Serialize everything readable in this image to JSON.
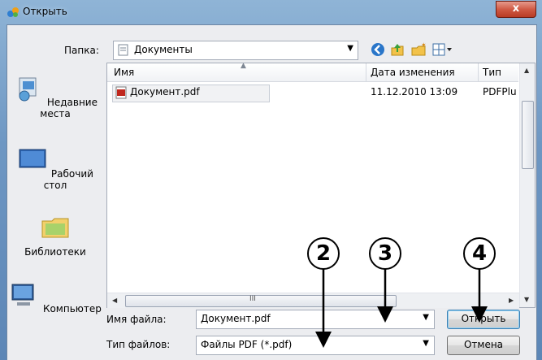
{
  "window": {
    "title": "Открыть",
    "close_label": "x"
  },
  "toolbar": {
    "folder_label": "Папка:",
    "folder_value": "Документы"
  },
  "places": [
    {
      "label": "Недавние места",
      "icon": "recent-places-icon"
    },
    {
      "label": "Рабочий стол",
      "icon": "desktop-icon"
    },
    {
      "label": "Библиотеки",
      "icon": "libraries-icon"
    },
    {
      "label": "Компьютер",
      "icon": "computer-icon"
    }
  ],
  "filelist": {
    "columns": [
      "Имя",
      "Дата изменения",
      "Тип"
    ],
    "rows": [
      {
        "name": "Документ.pdf",
        "date": "11.12.2010 13:09",
        "type": "PDFPlu"
      }
    ],
    "hscroll_glyph": "III"
  },
  "form": {
    "filename_label": "Имя файла:",
    "filename_value": "Документ.pdf",
    "filetype_label": "Тип файлов:",
    "filetype_value": "Файлы PDF (*.pdf)",
    "open_label": "Открыть",
    "cancel_label": "Отмена"
  },
  "callouts": [
    "2",
    "3",
    "4"
  ],
  "colors": {
    "accent": "#3c7fb1",
    "close": "#c8452f",
    "titlebar": "#7ea3cc"
  }
}
